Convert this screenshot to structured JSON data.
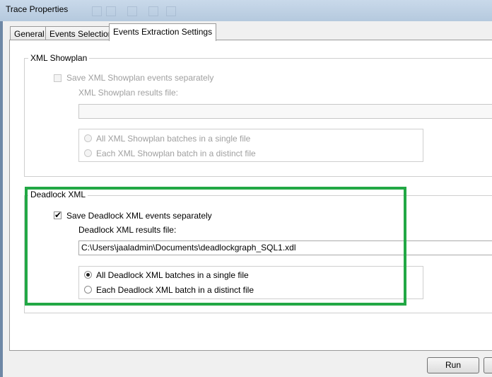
{
  "window": {
    "title": "Trace Properties"
  },
  "tabs": [
    {
      "label": "General",
      "active": false
    },
    {
      "label": "Events Selection",
      "active": false
    },
    {
      "label": "Events Extraction Settings",
      "active": true
    }
  ],
  "showplan": {
    "legend": "XML Showplan",
    "save_label": "Save XML Showplan events separately",
    "save_checked": false,
    "enabled": false,
    "results_label": "XML Showplan results file:",
    "results_value": "",
    "option_single": "All XML Showplan batches in a single file",
    "option_distinct": "Each XML Showplan batch in a distinct file"
  },
  "deadlock": {
    "legend": "Deadlock XML",
    "save_label": "Save Deadlock XML events separately",
    "save_checked": true,
    "results_label": "Deadlock XML results file:",
    "results_value": "C:\\Users\\jaaladmin\\Documents\\deadlockgraph_SQL1.xdl",
    "option_single": "All Deadlock XML batches in a single file",
    "option_distinct": "Each Deadlock XML batch in a distinct file",
    "selected_option": "single"
  },
  "buttons": {
    "run": "Run"
  },
  "colors": {
    "highlight": "#22a845",
    "titlebar": "#c9d9ea"
  }
}
